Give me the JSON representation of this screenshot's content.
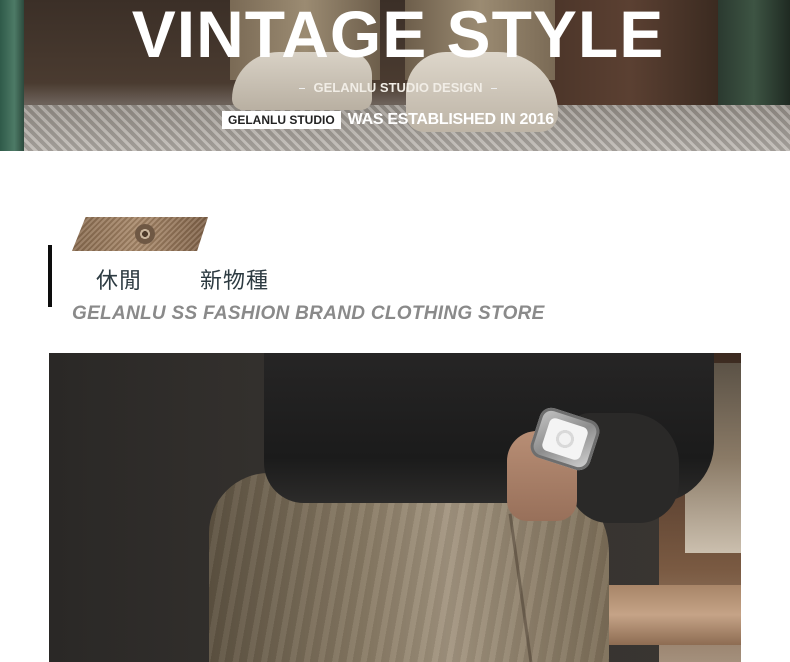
{
  "banner": {
    "title": "VINTAGE STYLE",
    "subtitle": "GELANLU STUDIO DESIGN",
    "badge": "GELANLU STUDIO",
    "established": "WAS ESTABLISHED IN 2016"
  },
  "section": {
    "label_1": "休閒",
    "label_2": "新物種",
    "tagline": "GELANLU SS FASHION BRAND CLOTHING STORE"
  },
  "colors": {
    "accent_bar": "#0d0d0d",
    "heading_text": "#2d3b42",
    "tagline_text": "#8a8a8a"
  }
}
